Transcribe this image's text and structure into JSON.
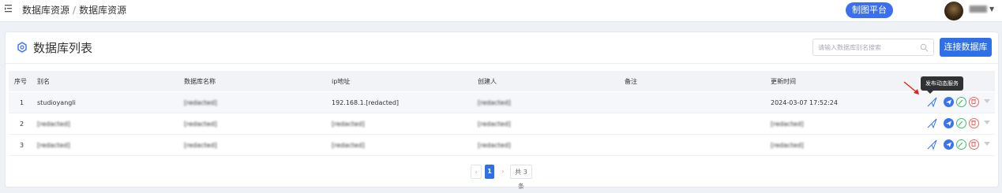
{
  "breadcrumb": {
    "part1": "数据库资源",
    "sep": "/",
    "part2": "数据库资源"
  },
  "header": {
    "platform_button": "制图平台",
    "user_name": "[redacted]"
  },
  "panel": {
    "title": "数据库列表",
    "search_placeholder": "请输入数据库别名搜索",
    "connect_button": "连接数据库"
  },
  "table": {
    "columns": [
      "序号",
      "别名",
      "数据库名称",
      "ip地址",
      "创建人",
      "备注",
      "更新时间"
    ],
    "rows": [
      {
        "index": "1",
        "alias": "studioyangli",
        "db_name": "[redacted]",
        "ip": "192.168.1.[redacted]",
        "creator": "[redacted]",
        "remark": "",
        "updated": "2024-03-07 17:52:24"
      },
      {
        "index": "2",
        "alias": "[redacted]",
        "db_name": "[redacted]",
        "ip": "[redacted]",
        "creator": "[redacted]",
        "remark": "",
        "updated": "[redacted]"
      },
      {
        "index": "3",
        "alias": "[redacted]",
        "db_name": "[redacted]",
        "ip": "[redacted]",
        "creator": "[redacted]",
        "remark": "",
        "updated": "[redacted]"
      }
    ]
  },
  "tooltip": "发布动态服务",
  "pagination": {
    "current": "1",
    "total": "共 3 条"
  },
  "colors": {
    "primary": "#2f6fe8",
    "green": "#3cbf6a",
    "red": "#f06565",
    "tooltip_bg": "#303133"
  },
  "icons": [
    "menu-icon",
    "database-icon",
    "search-icon",
    "publish-icon",
    "send-icon",
    "edit-icon",
    "delete-icon",
    "chevron-down-icon"
  ]
}
